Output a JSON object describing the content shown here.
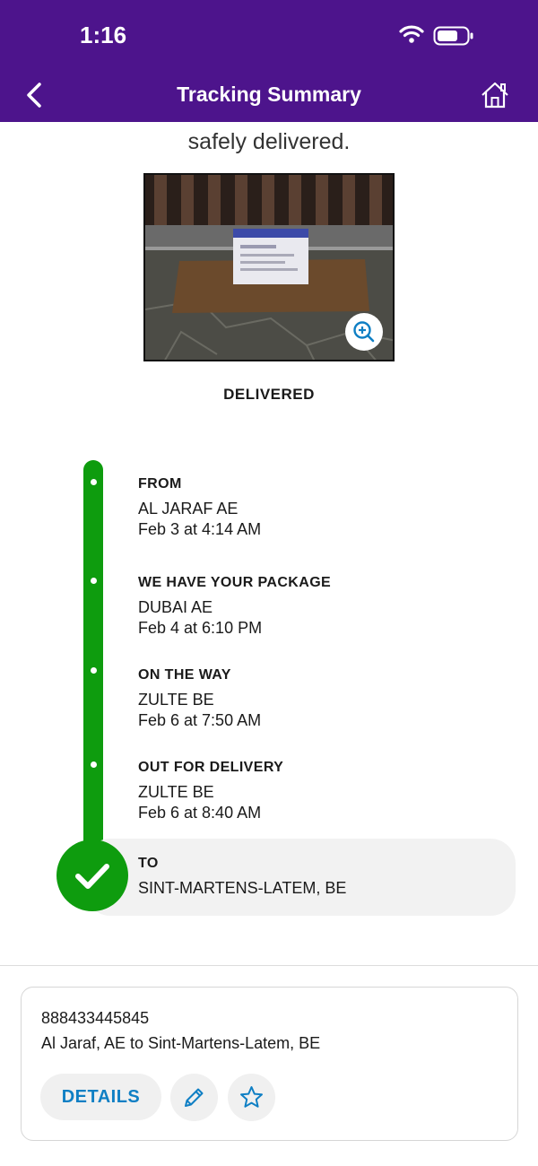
{
  "status_bar": {
    "time": "1:16"
  },
  "nav": {
    "title": "Tracking Summary",
    "back_icon": "chevron-left-icon",
    "home_icon": "home-icon"
  },
  "intro": {
    "visible_text": "safely delivered."
  },
  "photo": {
    "zoom_icon": "zoom-in-icon"
  },
  "status_label": "DELIVERED",
  "timeline": {
    "events": [
      {
        "title": "FROM",
        "location": "AL JARAF AE",
        "time": "Feb 3 at 4:14 AM"
      },
      {
        "title": "WE HAVE YOUR PACKAGE",
        "location": "DUBAI AE",
        "time": "Feb 4 at 6:10 PM"
      },
      {
        "title": "ON THE WAY",
        "location": "ZULTE BE",
        "time": "Feb 6 at 7:50 AM"
      },
      {
        "title": "OUT FOR DELIVERY",
        "location": "ZULTE BE",
        "time": "Feb 6 at 8:40 AM"
      }
    ],
    "destination": {
      "title": "TO",
      "location": "SINT-MARTENS-LATEM, BE",
      "icon": "checkmark-icon"
    }
  },
  "card": {
    "tracking_number": "888433445845",
    "route": "Al Jaraf, AE to Sint-Martens-Latem, BE",
    "details_label": "DETAILS",
    "edit_icon": "pencil-icon",
    "favorite_icon": "star-icon"
  },
  "colors": {
    "brand_purple": "#4d148c",
    "timeline_green": "#0e9c0e",
    "link_blue": "#0f7fc4"
  }
}
